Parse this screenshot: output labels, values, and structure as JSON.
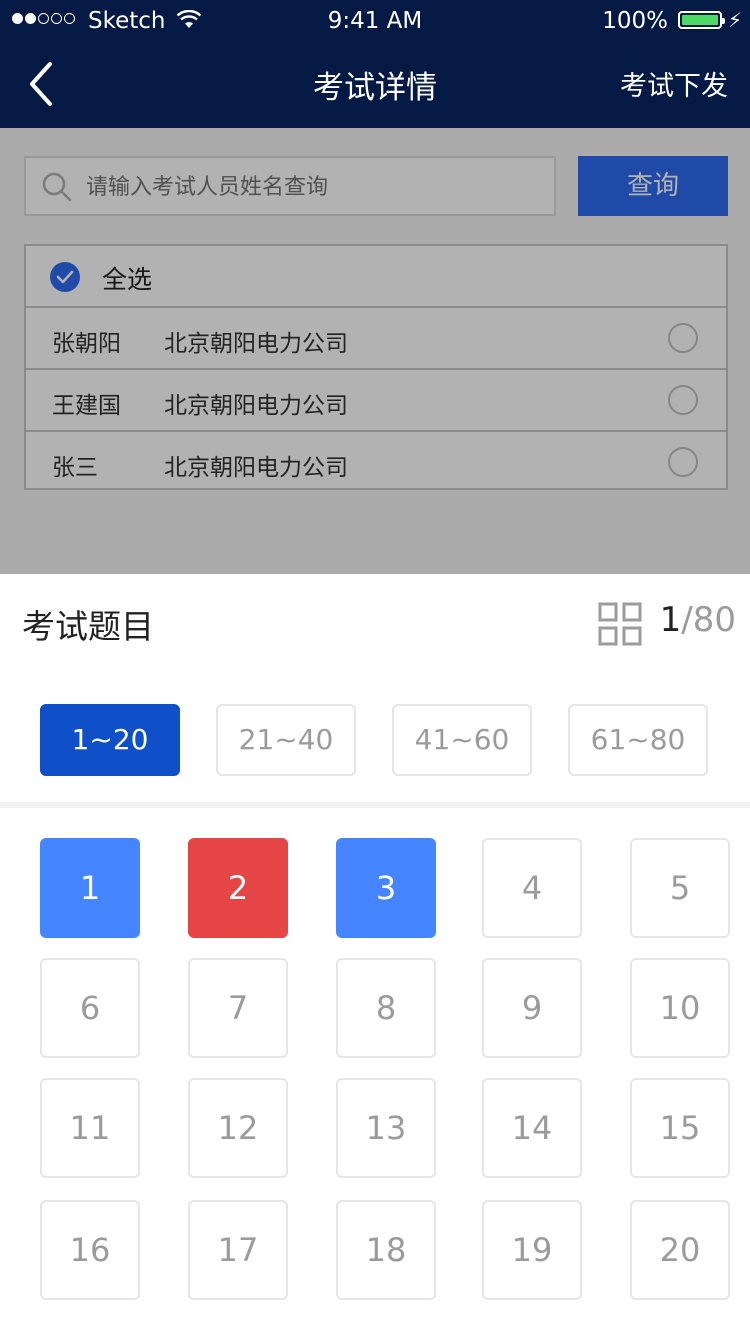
{
  "status_bar": {
    "carrier": "Sketch",
    "time": "9:41 AM",
    "battery": "100%"
  },
  "nav": {
    "title": "考试详情",
    "action": "考试下发"
  },
  "search": {
    "placeholder": "请输入考试人员姓名查询",
    "button": "查询"
  },
  "list": {
    "select_all": "全选",
    "rows": [
      {
        "name": "张朝阳",
        "company": "北京朝阳电力公司"
      },
      {
        "name": "王建国",
        "company": "北京朝阳电力公司"
      },
      {
        "name": "张三",
        "company": "北京朝阳电力公司"
      }
    ]
  },
  "sheet": {
    "title": "考试题目",
    "current": "1",
    "total": "/80",
    "ranges": [
      "1~20",
      "21~40",
      "41~60",
      "61~80"
    ],
    "questions": [
      "1",
      "2",
      "3",
      "4",
      "5",
      "6",
      "7",
      "8",
      "9",
      "10",
      "11",
      "12",
      "13",
      "14",
      "15",
      "16",
      "17",
      "18",
      "19",
      "20"
    ]
  },
  "colors": {
    "nav_bg": "#041a45",
    "accent": "#2d6af0",
    "range_active": "#0f4fc8",
    "answered": "#4585ff",
    "wrong": "#e54545"
  }
}
